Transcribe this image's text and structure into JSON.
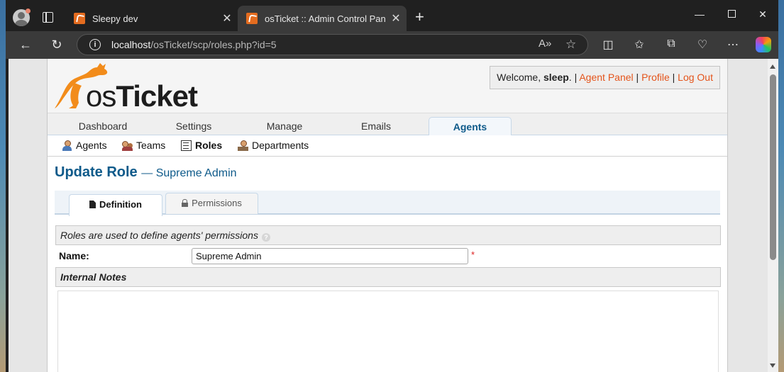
{
  "browser": {
    "tabs": [
      {
        "title": "Sleepy dev",
        "active": false
      },
      {
        "title": "osTicket :: Admin Control Panel",
        "active": true
      }
    ],
    "url_host": "localhost",
    "url_path": "/osTicket/scp/roles.php?id=5"
  },
  "header": {
    "logo_os": "os",
    "logo_ticket": "Ticket",
    "welcome_prefix": "Welcome, ",
    "username": "sleep",
    "welcome_suffix": ". | ",
    "links": {
      "agent_panel": "Agent Panel",
      "profile": "Profile",
      "logout": "Log Out"
    },
    "separator": " | "
  },
  "nav": {
    "tabs": [
      {
        "label": "Dashboard"
      },
      {
        "label": "Settings"
      },
      {
        "label": "Manage"
      },
      {
        "label": "Emails"
      },
      {
        "label": "Agents",
        "active": true
      }
    ]
  },
  "subnav": {
    "items": [
      {
        "label": "Agents"
      },
      {
        "label": "Teams"
      },
      {
        "label": "Roles",
        "active": true
      },
      {
        "label": "Departments"
      }
    ]
  },
  "page": {
    "title": "Update Role",
    "subtitle": "— Supreme Admin"
  },
  "form_tabs": {
    "definition": "Definition",
    "permissions": "Permissions"
  },
  "form": {
    "section_header": "Roles are used to define agents' permissions",
    "help": "?",
    "name_label": "Name:",
    "name_value": "Supreme Admin",
    "required_mark": "*",
    "notes_header": "Internal Notes"
  },
  "colors": {
    "brand_orange": "#e4541b",
    "link_blue": "#0e5a8a"
  }
}
